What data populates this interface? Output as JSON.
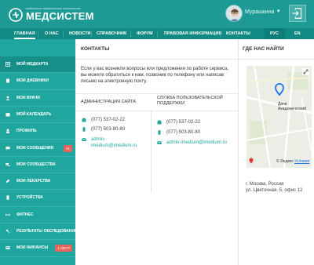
{
  "header": {
    "logo_tagline": "мобильное медицинское приложение",
    "logo_text": "МЕДСИСТЕМ",
    "user_name": "Мурашкина"
  },
  "nav": {
    "items": [
      "ГЛАВНАЯ",
      "О НАС",
      "НОВОСТИ",
      "СПРАВОЧНИК",
      "ФОРУМ",
      "ПРАВОВАЯ ИНФОРМАЦИЯ",
      "КОНТАКТЫ"
    ],
    "langs": [
      "РУС",
      "EN"
    ]
  },
  "sidebar": {
    "items": [
      {
        "label": "МОЙ МЕДКАРТА",
        "icon": "medcard-icon"
      },
      {
        "label": "МОИ ДНЕВНИКИ",
        "icon": "diary-icon"
      },
      {
        "label": "МОИ ВРАЧИ",
        "icon": "doctor-icon"
      },
      {
        "label": "МОЙ КАЛЕНДАРЬ",
        "icon": "calendar-icon"
      },
      {
        "label": "ПРОФИЛЬ",
        "icon": "profile-icon"
      },
      {
        "label": "МОИ СООБЩЕНИЯ",
        "icon": "messages-icon",
        "badge": "11"
      },
      {
        "label": "МОИ СООБЩЕСТВА",
        "icon": "community-icon"
      },
      {
        "label": "МОИ ЛЕКАРСТВА",
        "icon": "pill-icon"
      },
      {
        "label": "УСТРОЙСТВА",
        "icon": "device-icon"
      },
      {
        "label": "ФИТНЕС",
        "icon": "fitness-icon"
      },
      {
        "label": "РЕЗУЛЬТАТЫ ОБСЛЕДОВАНИЙ",
        "icon": "results-icon"
      },
      {
        "label": "МОИ ФИНАНСЫ",
        "icon": "finance-icon",
        "badge": "1 000 Р"
      }
    ]
  },
  "contacts": {
    "title": "КОНТАКТЫ",
    "intro": "Если у вас возникли вопросы или предложения по работе сервиса, вы можете обратиться к нам, позвонив по телефону или написав письмо на электронную почту.",
    "admin": {
      "title": "АДМИНИСТРАЦИЯ САЙТА",
      "phone1": "(077) 537-02-22",
      "phone2": "(077) 503-80-80",
      "email": "admin-imedium@imedium.ru"
    },
    "support": {
      "title": "СЛУЖБА ПОЛЬЗОВАТЕЛЬСКОЙ ПОДДЕРЖКИ",
      "phone1": "(077) 537-02-22",
      "phone2": "(077) 503-80-80",
      "email": "admin-imedium@imedium.ru"
    }
  },
  "map_panel": {
    "title": "ГДЕ НАС НАЙТИ",
    "map_label": "Дачи Академический",
    "map_attrib": "© Яндекс",
    "map_terms": "Условия",
    "address_line1": "г. Москва, Россия",
    "address_line2": "ул. Цветочная, 5, офис 12"
  },
  "colors": {
    "accent": "#1fa69e",
    "header": "#1d9a93",
    "badge": "#e8655c"
  }
}
